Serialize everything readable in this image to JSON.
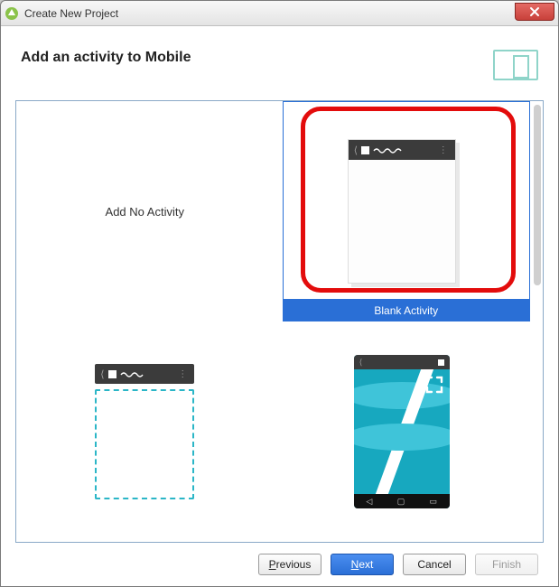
{
  "window": {
    "title": "Create New Project"
  },
  "header": {
    "title": "Add an activity to Mobile"
  },
  "activities": {
    "none_label": "Add No Activity",
    "blank_label": "Blank Activity"
  },
  "buttons": {
    "previous": "Previous",
    "next": "Next",
    "cancel": "Cancel",
    "finish": "Finish"
  }
}
